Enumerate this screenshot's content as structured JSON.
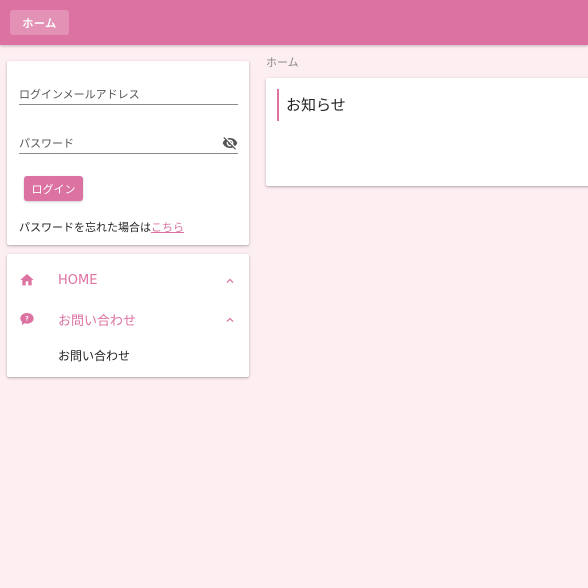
{
  "header": {
    "home_button": "ホーム",
    "accent_color": "#dc72a1"
  },
  "login": {
    "email_label": "ログインメールアドレス",
    "password_label": "パスワード",
    "password_toggle_icon": "visibility-off-icon",
    "login_button": "ログイン",
    "forgot_prefix": "パスワードを忘れた場合は",
    "forgot_link": "こちら"
  },
  "nav": {
    "items": [
      {
        "label": "HOME",
        "icon": "home-icon",
        "expanded": true
      },
      {
        "label": "お問い合わせ",
        "icon": "chat-question-icon",
        "expanded": true
      }
    ],
    "sub_items": [
      "お問い合わせ"
    ]
  },
  "main": {
    "breadcrumb": "ホーム",
    "notice_title": "お知らせ"
  }
}
